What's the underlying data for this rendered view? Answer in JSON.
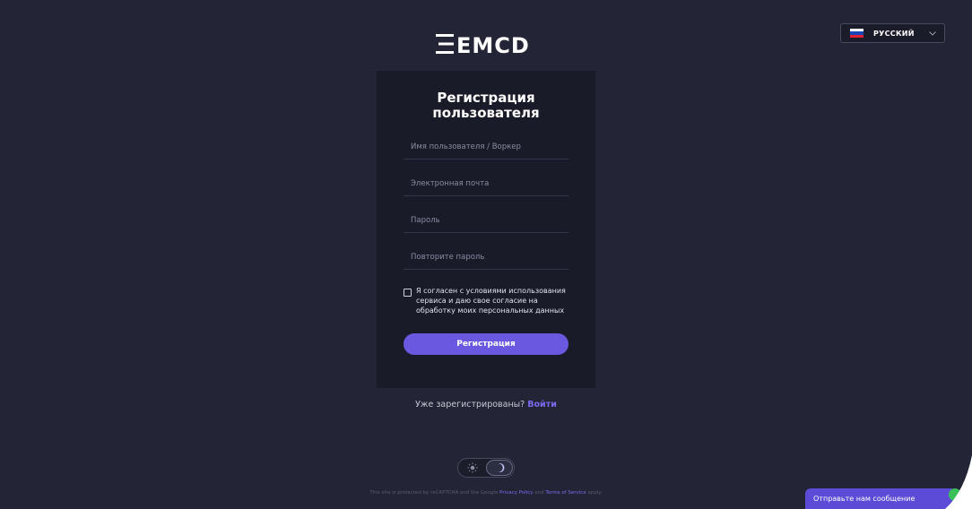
{
  "header": {
    "logo": "EMCD",
    "language": {
      "label": "РУССКИЙ",
      "flag": "russia-flag"
    }
  },
  "form": {
    "title_line1": "Регистрация",
    "title_line2": "пользователя",
    "fields": [
      {
        "placeholder": "Имя пользователя / Воркер",
        "value": ""
      },
      {
        "placeholder": "Электронная почта",
        "value": ""
      },
      {
        "placeholder": "Пароль",
        "value": ""
      },
      {
        "placeholder": "Повторите пароль",
        "value": ""
      }
    ],
    "agreement": {
      "checked": false,
      "text": "Я согласен с условиями использования сервиса и даю свое согласие на обработку моих персональных данных"
    },
    "submit_label": "Регистрация"
  },
  "login_prompt": {
    "text": "Уже зарегистрированы?",
    "link": "Войти"
  },
  "theme": {
    "selected": "dark"
  },
  "recaptcha": {
    "prefix": "This site is protected by reCAPTCHA and the Google",
    "privacy": "Privacy Policy",
    "and": "and",
    "terms": "Terms of Service",
    "suffix": "apply."
  },
  "chat": {
    "label": "Отправьте нам сообщение"
  },
  "colors": {
    "background": "#232435",
    "card": "#1a1b29",
    "accent": "#6a58e1",
    "link": "#7b6bf0",
    "chat": "#5b4bd6"
  }
}
